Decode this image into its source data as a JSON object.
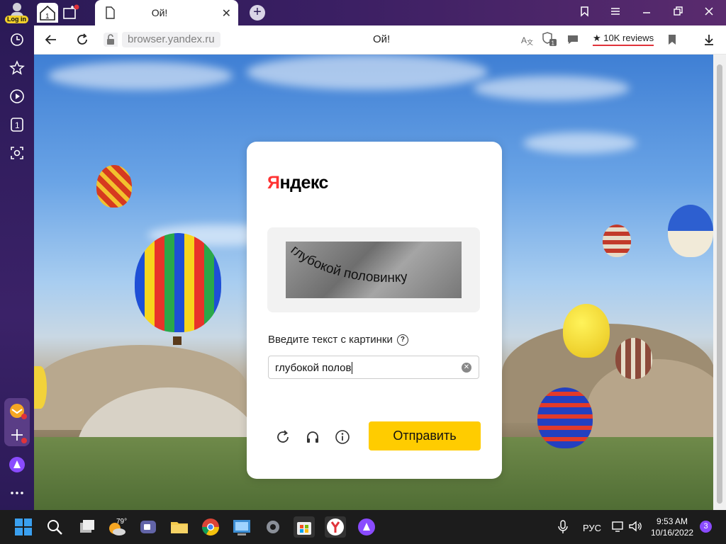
{
  "topbar": {
    "login_label": "Log in",
    "tab_title": "Ой!",
    "tab_close": "✕",
    "add_tab": "+",
    "tab_count": "1"
  },
  "address": {
    "url": "browser.yandex.ru",
    "page_title": "Ой!",
    "reviews": "★ 10K reviews",
    "protect_count": "1"
  },
  "sidebar": {
    "tab_counter": "1"
  },
  "captcha": {
    "logo": "Яндекс",
    "label": "Введите текст с картинки",
    "help": "?",
    "input_value": "глубокой полов",
    "captcha_text": "глубокой половинку",
    "submit": "Отправить"
  },
  "taskbar": {
    "weather_temp": "79°",
    "lang": "РУС",
    "time": "9:53 AM",
    "date": "10/16/2022",
    "notif_count": "3"
  },
  "colors": {
    "accent_yellow": "#ffcc00",
    "yandex_red": "#ff3333",
    "sidebar_purple": "#2b1a57"
  }
}
